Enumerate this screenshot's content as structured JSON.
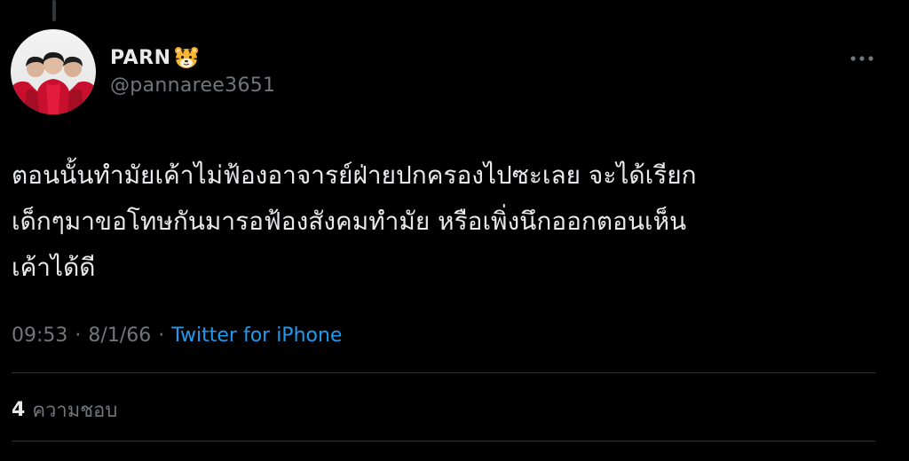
{
  "author": {
    "display_name": "PARN",
    "emoji_icon": "tiger-face-icon",
    "handle": "@pannaree3651",
    "avatar": "profile-photo"
  },
  "tweet": {
    "lines": [
      "ตอนนั้นทำมัยเค้าไม่ฟ้องอาจารย์ฝ่ายปกครองไปซะเลย จะได้เรียก",
      "เด็กๆมาขอโทษกันมารอฟ้องสังคมทำมัย หรือเพิ่งนึกออกตอนเห็น",
      "เค้าได้ดี"
    ]
  },
  "meta": {
    "time": "09:53",
    "separator": "·",
    "date": "8/1/66",
    "source": "Twitter for iPhone"
  },
  "stats": {
    "likes_count": "4",
    "likes_label": "ความชอบ"
  },
  "icons": {
    "more": "more-horizontal-icon"
  },
  "colors": {
    "background": "#000000",
    "text": "#e7e9ea",
    "secondary": "#71767b",
    "link": "#1d9bf0",
    "divider": "#2f3336"
  }
}
